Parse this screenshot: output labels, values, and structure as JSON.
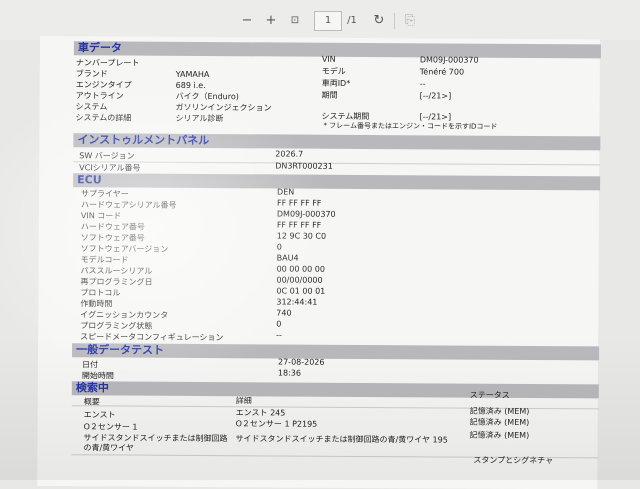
{
  "toolbar": {
    "minus": "−",
    "plus": "+",
    "fit": "⊡",
    "page_current": "1",
    "page_total": "/1",
    "rotate": "↻",
    "doc": "⎘"
  },
  "vehicle": {
    "title": "車データ",
    "left": [
      {
        "label": "ナンバープレート",
        "value": ""
      },
      {
        "label": "ブランド",
        "value": "YAMAHA"
      },
      {
        "label": "エンジンタイプ",
        "value": "689 i.e."
      },
      {
        "label": "アウトライン",
        "value": "バイク（Enduro)"
      },
      {
        "label": "システム",
        "value": "ガソリンインジェクション"
      },
      {
        "label": "システムの詳細",
        "value": "シリアル診断"
      }
    ],
    "right": [
      {
        "label": "VIN",
        "value": "DM09J-000370"
      },
      {
        "label": "モデル",
        "value": "Ténéré 700"
      },
      {
        "label": "車両ID*",
        "value": "--"
      },
      {
        "label": "期間",
        "value": "[--/21>]"
      },
      {
        "label": "システム期間",
        "value": "[--/21>]"
      }
    ],
    "note": "* フレーム番号またはエンジン・コードを示すIDコード"
  },
  "instrument": {
    "title": "インストゥルメントパネル",
    "rows": [
      {
        "label": "SW バージョン",
        "value": "2026.7"
      },
      {
        "label": "VCIシリアル番号",
        "value": "DN3RT000231"
      }
    ]
  },
  "ecu": {
    "title": "ECU",
    "rows": [
      {
        "label": "サプライヤー",
        "value": "DEN"
      },
      {
        "label": "ハードウェアシリアル番号",
        "value": "FF FF FF FF"
      },
      {
        "label": "VIN コード",
        "value": "DM09J-000370"
      },
      {
        "label": "ハードウェア番号",
        "value": "FF FF FF FF"
      },
      {
        "label": "ソフトウェア番号",
        "value": "12 9C 30 C0"
      },
      {
        "label": "ソフトウェアバージョン",
        "value": "0"
      },
      {
        "label": "モデルコード",
        "value": "BAU4"
      },
      {
        "label": "パススルーシリアル",
        "value": "00 00 00 00"
      },
      {
        "label": "再プログラミング日",
        "value": "00/00/0000"
      },
      {
        "label": "プロトコル",
        "value": "0C 01 00 01"
      },
      {
        "label": "作動時間",
        "value": "312:44:41"
      },
      {
        "label": "イグニッションカウンタ",
        "value": "740"
      },
      {
        "label": "プログラミング状態",
        "value": "0"
      },
      {
        "label": "スピードメータコンフィギュレーション",
        "value": "--"
      }
    ]
  },
  "general": {
    "title": "一般データテスト",
    "rows": [
      {
        "label": "日付",
        "value": "27-08-2026"
      },
      {
        "label": "開始時間",
        "value": "18:36"
      }
    ]
  },
  "search": {
    "title": "検索中",
    "headers": {
      "summary": "概要",
      "detail": "詳細",
      "status": "ステータス"
    },
    "rows": [
      {
        "summary": "エンスト",
        "detail": "エンスト 245",
        "status": "記憶済み (MEM)"
      },
      {
        "summary": "O２センサー 1",
        "detail": "O２センサー 1 P2195",
        "status": "記憶済み (MEM)"
      },
      {
        "summary": "サイドスタンドスイッチまたは制御回路の青/黄ワイヤ",
        "detail": "サイドスタンドスイッチまたは制御回路の青/黄ワイヤ 195",
        "status": "記憶済み (MEM)"
      }
    ]
  },
  "footer": {
    "stamp": "スタンプとシグネチャ"
  }
}
